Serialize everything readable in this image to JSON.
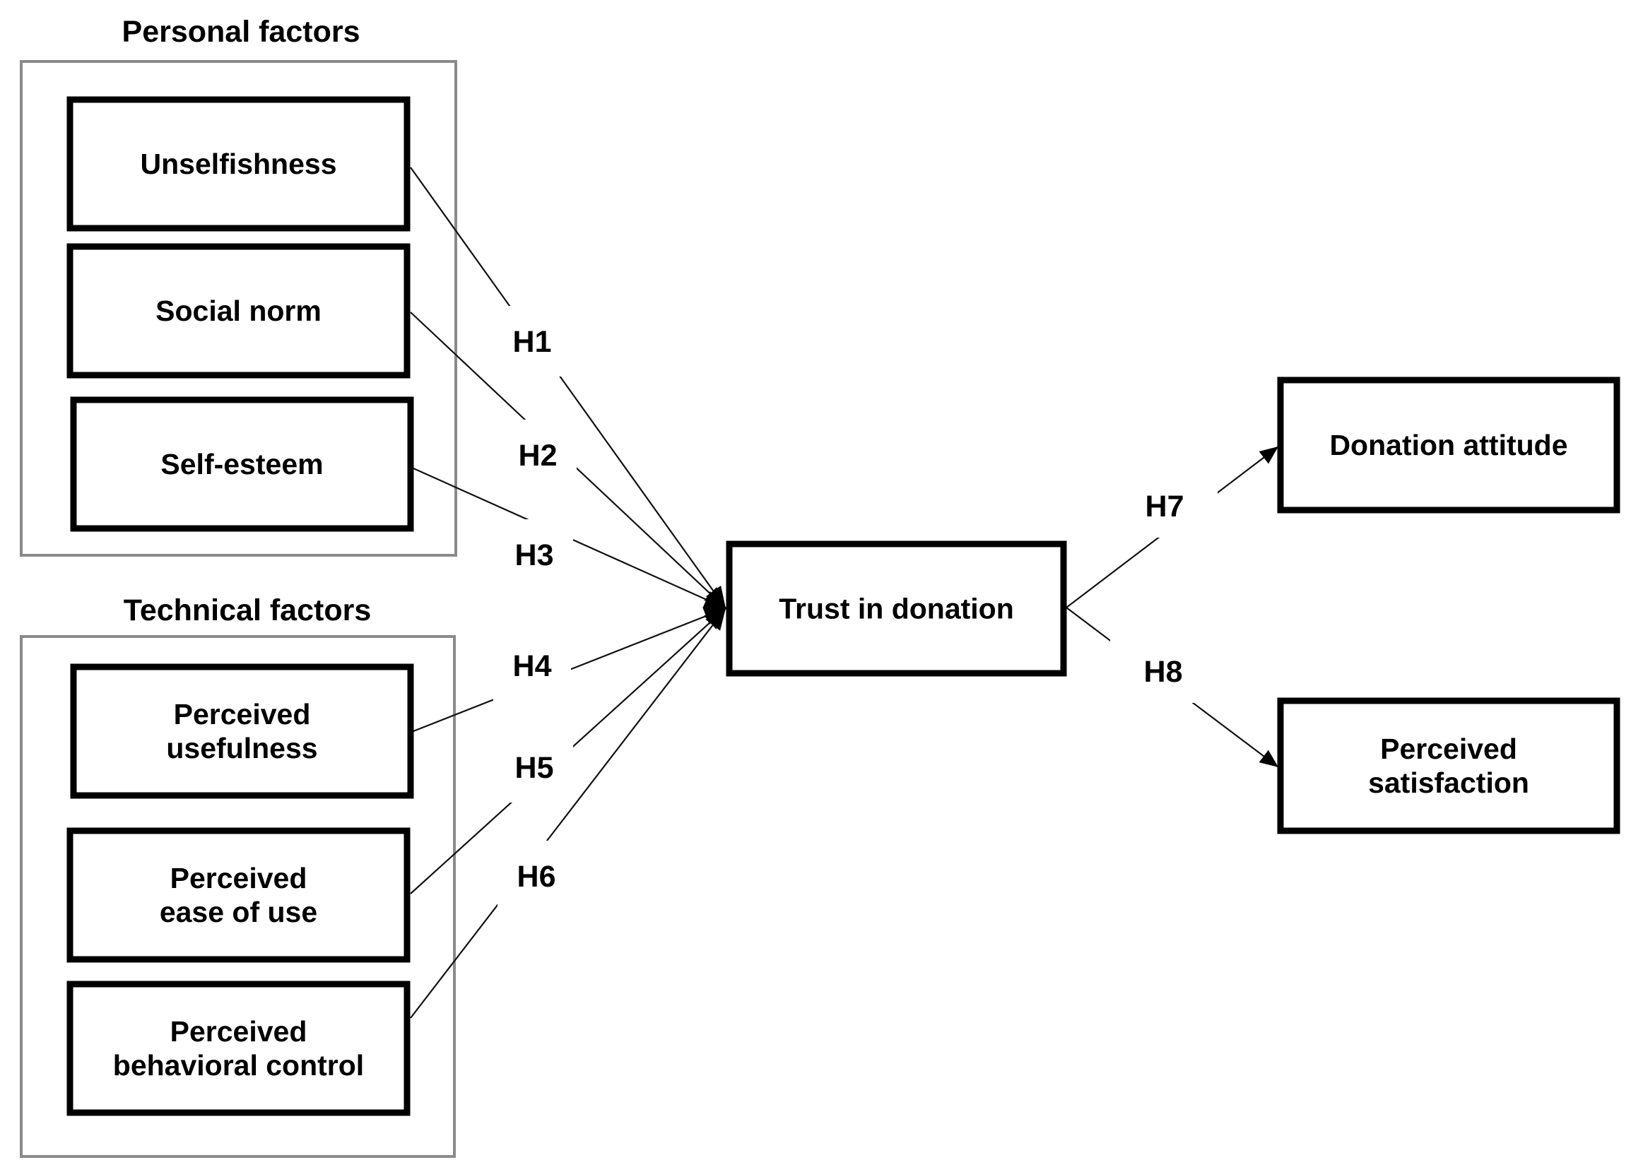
{
  "groups": [
    {
      "id": "personal",
      "title": "Personal factors"
    },
    {
      "id": "technical",
      "title": "Technical factors"
    }
  ],
  "nodes": {
    "unselfishness": {
      "lines": [
        "Unselfishness"
      ],
      "group": "personal"
    },
    "social_norm": {
      "lines": [
        "Social norm"
      ],
      "group": "personal"
    },
    "self_esteem": {
      "lines": [
        "Self-esteem"
      ],
      "group": "personal"
    },
    "perceived_usefulness": {
      "lines": [
        "Perceived",
        "usefulness"
      ],
      "group": "technical"
    },
    "perceived_ease_of_use": {
      "lines": [
        "Perceived",
        "ease of use"
      ],
      "group": "technical"
    },
    "perceived_behavioral_control": {
      "lines": [
        "Perceived",
        "behavioral control"
      ],
      "group": "technical"
    },
    "trust_in_donation": {
      "lines": [
        "Trust in donation"
      ]
    },
    "donation_attitude": {
      "lines": [
        "Donation attitude"
      ]
    },
    "perceived_satisfaction": {
      "lines": [
        "Perceived",
        "satisfaction"
      ]
    }
  },
  "hypotheses": [
    {
      "label": "H1",
      "from": "unselfishness",
      "to": "trust_in_donation"
    },
    {
      "label": "H2",
      "from": "social_norm",
      "to": "trust_in_donation"
    },
    {
      "label": "H3",
      "from": "self_esteem",
      "to": "trust_in_donation"
    },
    {
      "label": "H4",
      "from": "perceived_usefulness",
      "to": "trust_in_donation"
    },
    {
      "label": "H5",
      "from": "perceived_ease_of_use",
      "to": "trust_in_donation"
    },
    {
      "label": "H6",
      "from": "perceived_behavioral_control",
      "to": "trust_in_donation"
    },
    {
      "label": "H7",
      "from": "trust_in_donation",
      "to": "donation_attitude"
    },
    {
      "label": "H8",
      "from": "trust_in_donation",
      "to": "perceived_satisfaction"
    }
  ],
  "colors": {
    "node_stroke": "#000000",
    "group_stroke": "#8a8a8a",
    "background": "#ffffff"
  }
}
